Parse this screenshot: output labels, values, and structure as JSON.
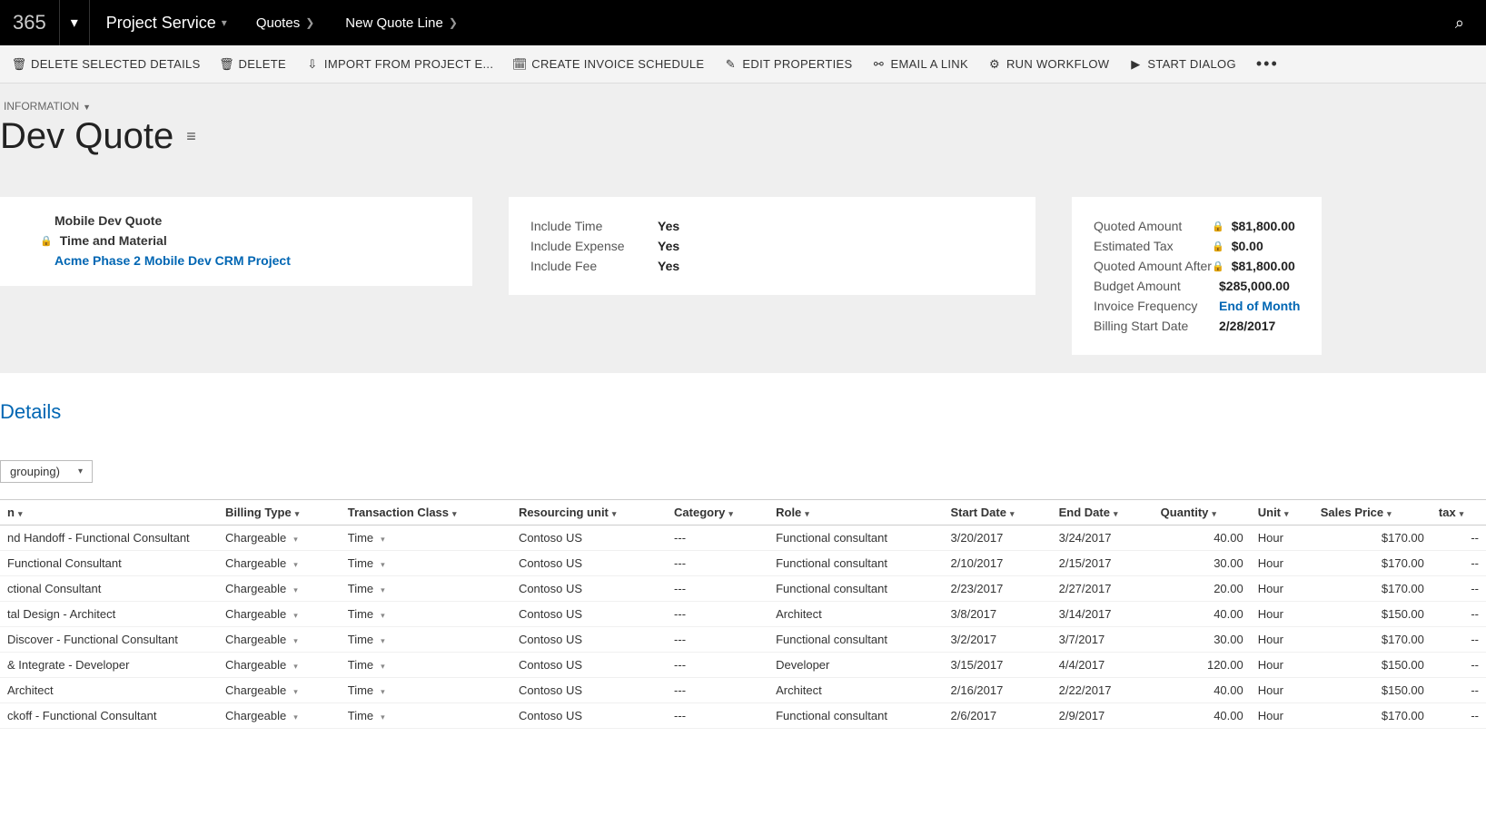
{
  "nav": {
    "brand": "365",
    "app": "Project Service",
    "crumbs": [
      "Quotes",
      "New Quote Line"
    ]
  },
  "commands": {
    "delete_selected": "DELETE SELECTED DETAILS",
    "delete": "DELETE",
    "import": "IMPORT FROM PROJECT E...",
    "create_invoice": "CREATE INVOICE SCHEDULE",
    "edit_props": "EDIT PROPERTIES",
    "email": "EMAIL A LINK",
    "run_workflow": "RUN WORKFLOW",
    "start_dialog": "START DIALOG"
  },
  "header": {
    "info_label": "INFORMATION",
    "title": "Dev Quote"
  },
  "summary": {
    "left": {
      "name": "Mobile Dev Quote",
      "billing_method": "Time and Material",
      "project": "Acme Phase 2 Mobile Dev CRM Project"
    },
    "mid": {
      "include_time_lbl": "Include Time",
      "include_time": "Yes",
      "include_expense_lbl": "Include Expense",
      "include_expense": "Yes",
      "include_fee_lbl": "Include Fee",
      "include_fee": "Yes"
    },
    "right": {
      "quoted_amount_lbl": "Quoted Amount",
      "quoted_amount": "$81,800.00",
      "estimated_tax_lbl": "Estimated Tax",
      "estimated_tax": "$0.00",
      "quoted_after_lbl": "Quoted Amount After",
      "quoted_after": "$81,800.00",
      "budget_lbl": "Budget Amount",
      "budget": "$285,000.00",
      "invoice_freq_lbl": "Invoice Frequency",
      "invoice_freq": "End of Month",
      "billing_start_lbl": "Billing Start Date",
      "billing_start": "2/28/2017"
    }
  },
  "details": {
    "title": "Details",
    "grouping_label": "grouping)",
    "columns": {
      "desc": "n",
      "billing_type": "Billing Type",
      "transaction_class": "Transaction Class",
      "resourcing_unit": "Resourcing unit",
      "category": "Category",
      "role": "Role",
      "start_date": "Start Date",
      "end_date": "End Date",
      "quantity": "Quantity",
      "unit": "Unit",
      "sales_price": "Sales Price",
      "tax": "tax"
    },
    "rows": [
      {
        "desc": "nd Handoff - Functional Consultant",
        "billing_type": "Chargeable",
        "tclass": "Time",
        "runit": "Contoso US",
        "category": "---",
        "role": "Functional consultant",
        "start": "3/20/2017",
        "end": "3/24/2017",
        "qty": "40.00",
        "unit": "Hour",
        "price": "$170.00",
        "tax": "--"
      },
      {
        "desc": "Functional Consultant",
        "billing_type": "Chargeable",
        "tclass": "Time",
        "runit": "Contoso US",
        "category": "---",
        "role": "Functional consultant",
        "start": "2/10/2017",
        "end": "2/15/2017",
        "qty": "30.00",
        "unit": "Hour",
        "price": "$170.00",
        "tax": "--"
      },
      {
        "desc": "ctional Consultant",
        "billing_type": "Chargeable",
        "tclass": "Time",
        "runit": "Contoso US",
        "category": "---",
        "role": "Functional consultant",
        "start": "2/23/2017",
        "end": "2/27/2017",
        "qty": "20.00",
        "unit": "Hour",
        "price": "$170.00",
        "tax": "--"
      },
      {
        "desc": "tal Design - Architect",
        "billing_type": "Chargeable",
        "tclass": "Time",
        "runit": "Contoso US",
        "category": "---",
        "role": "Architect",
        "start": "3/8/2017",
        "end": "3/14/2017",
        "qty": "40.00",
        "unit": "Hour",
        "price": "$150.00",
        "tax": "--"
      },
      {
        "desc": "Discover - Functional Consultant",
        "billing_type": "Chargeable",
        "tclass": "Time",
        "runit": "Contoso US",
        "category": "---",
        "role": "Functional consultant",
        "start": "3/2/2017",
        "end": "3/7/2017",
        "qty": "30.00",
        "unit": "Hour",
        "price": "$170.00",
        "tax": "--"
      },
      {
        "desc": " & Integrate - Developer",
        "billing_type": "Chargeable",
        "tclass": "Time",
        "runit": "Contoso US",
        "category": "---",
        "role": "Developer",
        "start": "3/15/2017",
        "end": "4/4/2017",
        "qty": "120.00",
        "unit": "Hour",
        "price": "$150.00",
        "tax": "--"
      },
      {
        "desc": "Architect",
        "billing_type": "Chargeable",
        "tclass": "Time",
        "runit": "Contoso US",
        "category": "---",
        "role": "Architect",
        "start": "2/16/2017",
        "end": "2/22/2017",
        "qty": "40.00",
        "unit": "Hour",
        "price": "$150.00",
        "tax": "--"
      },
      {
        "desc": "ckoff - Functional Consultant",
        "billing_type": "Chargeable",
        "tclass": "Time",
        "runit": "Contoso US",
        "category": "---",
        "role": "Functional consultant",
        "start": "2/6/2017",
        "end": "2/9/2017",
        "qty": "40.00",
        "unit": "Hour",
        "price": "$170.00",
        "tax": "--"
      }
    ]
  }
}
